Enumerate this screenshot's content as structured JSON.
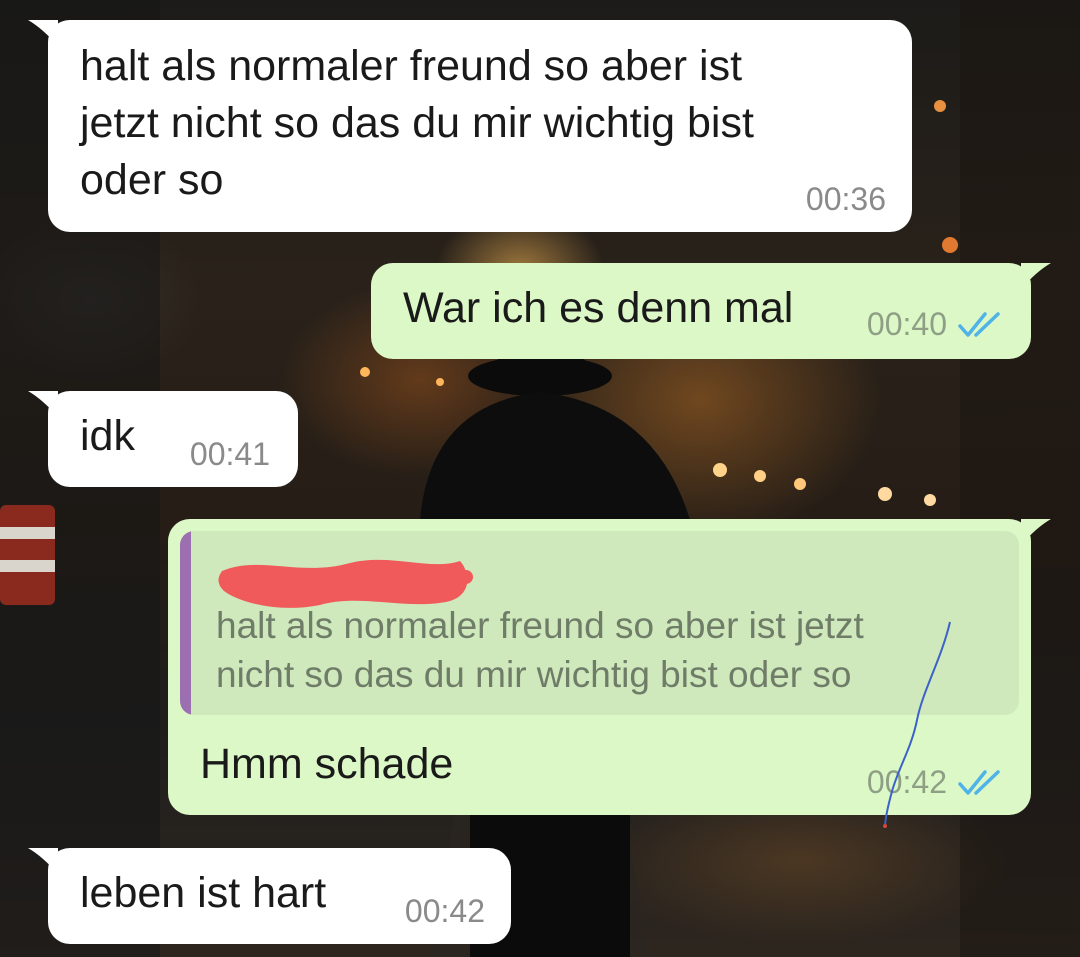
{
  "colors": {
    "incoming_bubble": "#ffffff",
    "outgoing_bubble": "#dcf8c6",
    "quote_bar": "#9c6fb0",
    "read_ticks": "#4fb3e8",
    "redaction": "#f05a5a"
  },
  "messages": [
    {
      "direction": "incoming",
      "text": "halt als normaler freund so aber ist\njetzt nicht so das du mir wichtig bist\noder so",
      "time": "00:36"
    },
    {
      "direction": "outgoing",
      "text": "War ich es denn mal",
      "time": "00:40",
      "status_icon": "double-check-read-icon"
    },
    {
      "direction": "incoming",
      "text": "idk",
      "time": "00:41"
    },
    {
      "direction": "outgoing",
      "quoted_text": "halt als normaler freund so aber ist jetzt\nnicht so das du mir wichtig bist oder so",
      "quoted_author_redacted": true,
      "text": "Hmm schade",
      "time": "00:42",
      "status_icon": "double-check-read-icon"
    },
    {
      "direction": "incoming",
      "text": "leben ist hart",
      "time": "00:42"
    }
  ]
}
